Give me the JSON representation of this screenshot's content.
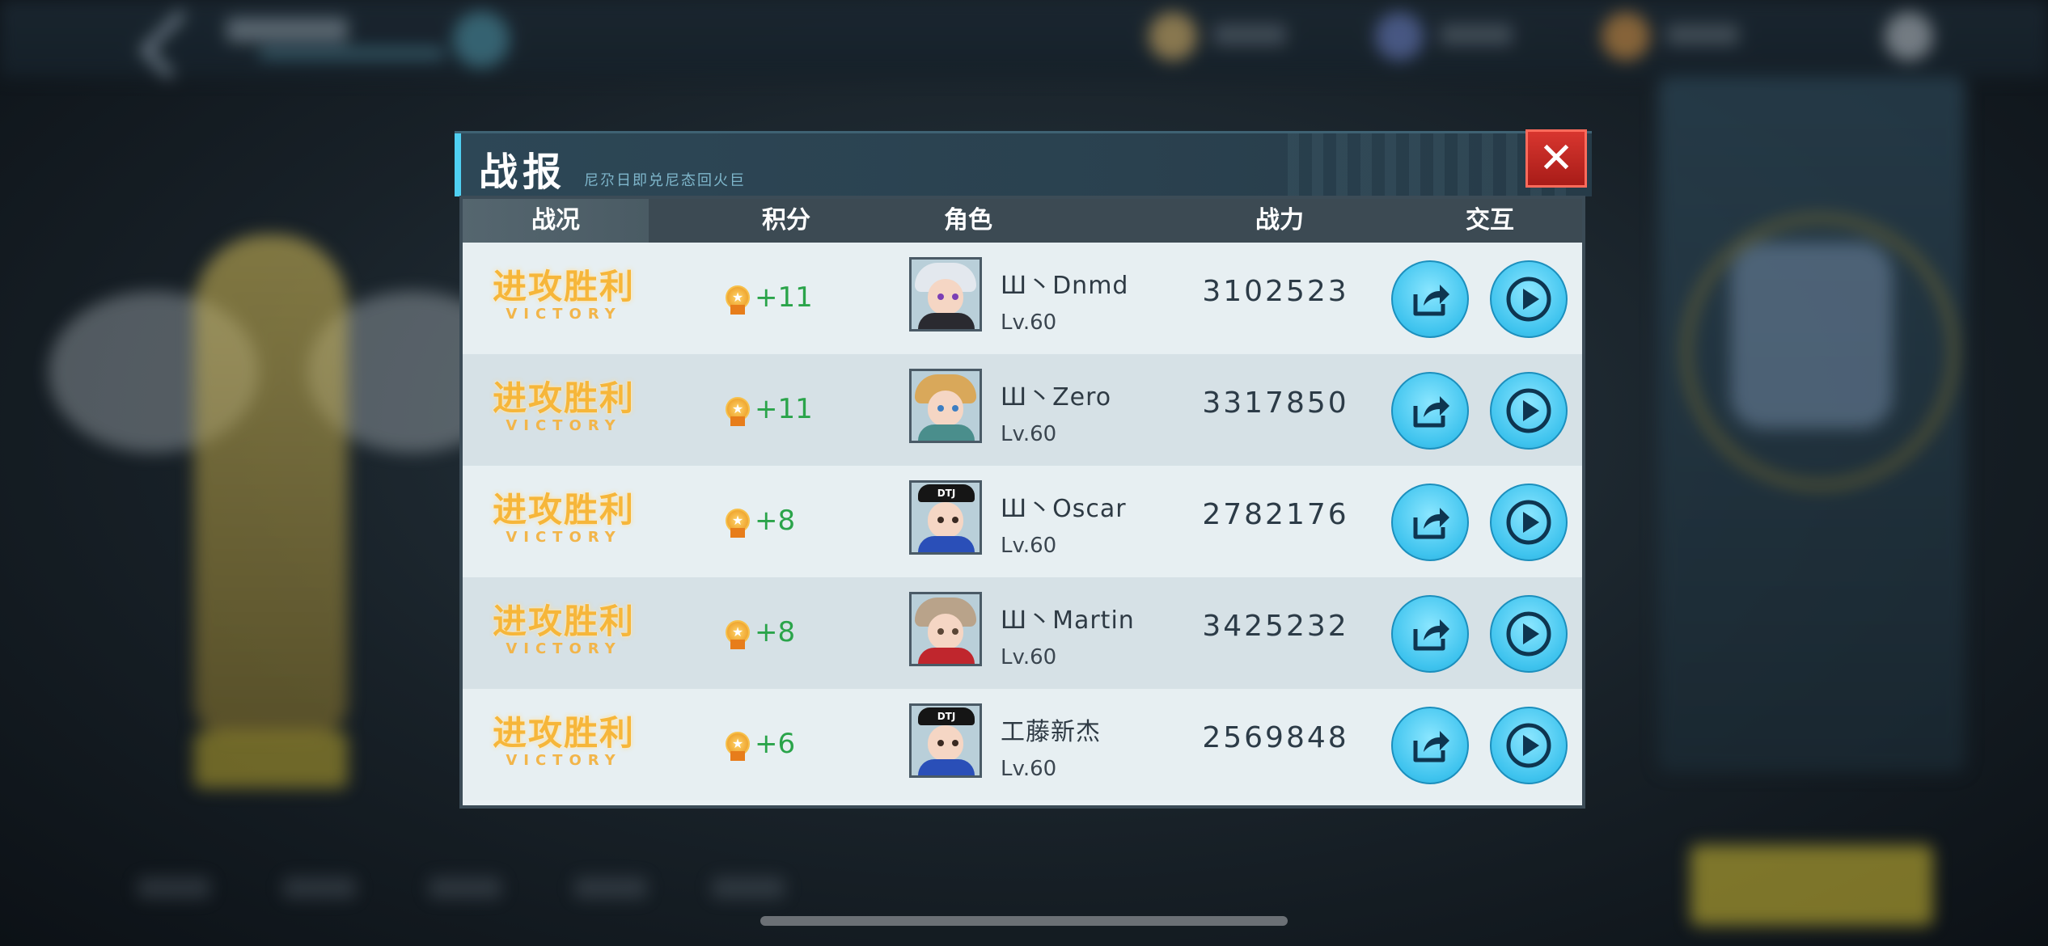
{
  "dialog": {
    "title": "战报",
    "subtitle": "尼尕日即兑尼态回火巨",
    "close_symbol": "✕"
  },
  "table": {
    "headers": [
      "战况",
      "积分",
      "角色",
      "战力",
      "交互"
    ],
    "rows": [
      {
        "result": "进攻胜利",
        "result_en": "VICTORY",
        "score": "+11",
        "name": "Ш丶Dnmd",
        "level": "Lv.60",
        "power": "3102523",
        "avatar": "white-hair-character"
      },
      {
        "result": "进攻胜利",
        "result_en": "VICTORY",
        "score": "+11",
        "name": "Ш丶Zero",
        "level": "Lv.60",
        "power": "3317850",
        "avatar": "blonde-hair-character"
      },
      {
        "result": "进攻胜利",
        "result_en": "VICTORY",
        "score": "+8",
        "name": "Ш丶Oscar",
        "level": "Lv.60",
        "power": "2782176",
        "avatar": "cap-character"
      },
      {
        "result": "进攻胜利",
        "result_en": "VICTORY",
        "score": "+8",
        "name": "Ш丶Martin",
        "level": "Lv.60",
        "power": "3425232",
        "avatar": "ash-hair-character"
      },
      {
        "result": "进攻胜利",
        "result_en": "VICTORY",
        "score": "+6",
        "name": "工藤新杰",
        "level": "Lv.60",
        "power": "2569848",
        "avatar": "cap-character"
      }
    ]
  },
  "colors": {
    "victory": "#f6b63a",
    "score": "#2aa44a",
    "accent": "#4fd0f2",
    "close": "#d8362f"
  }
}
